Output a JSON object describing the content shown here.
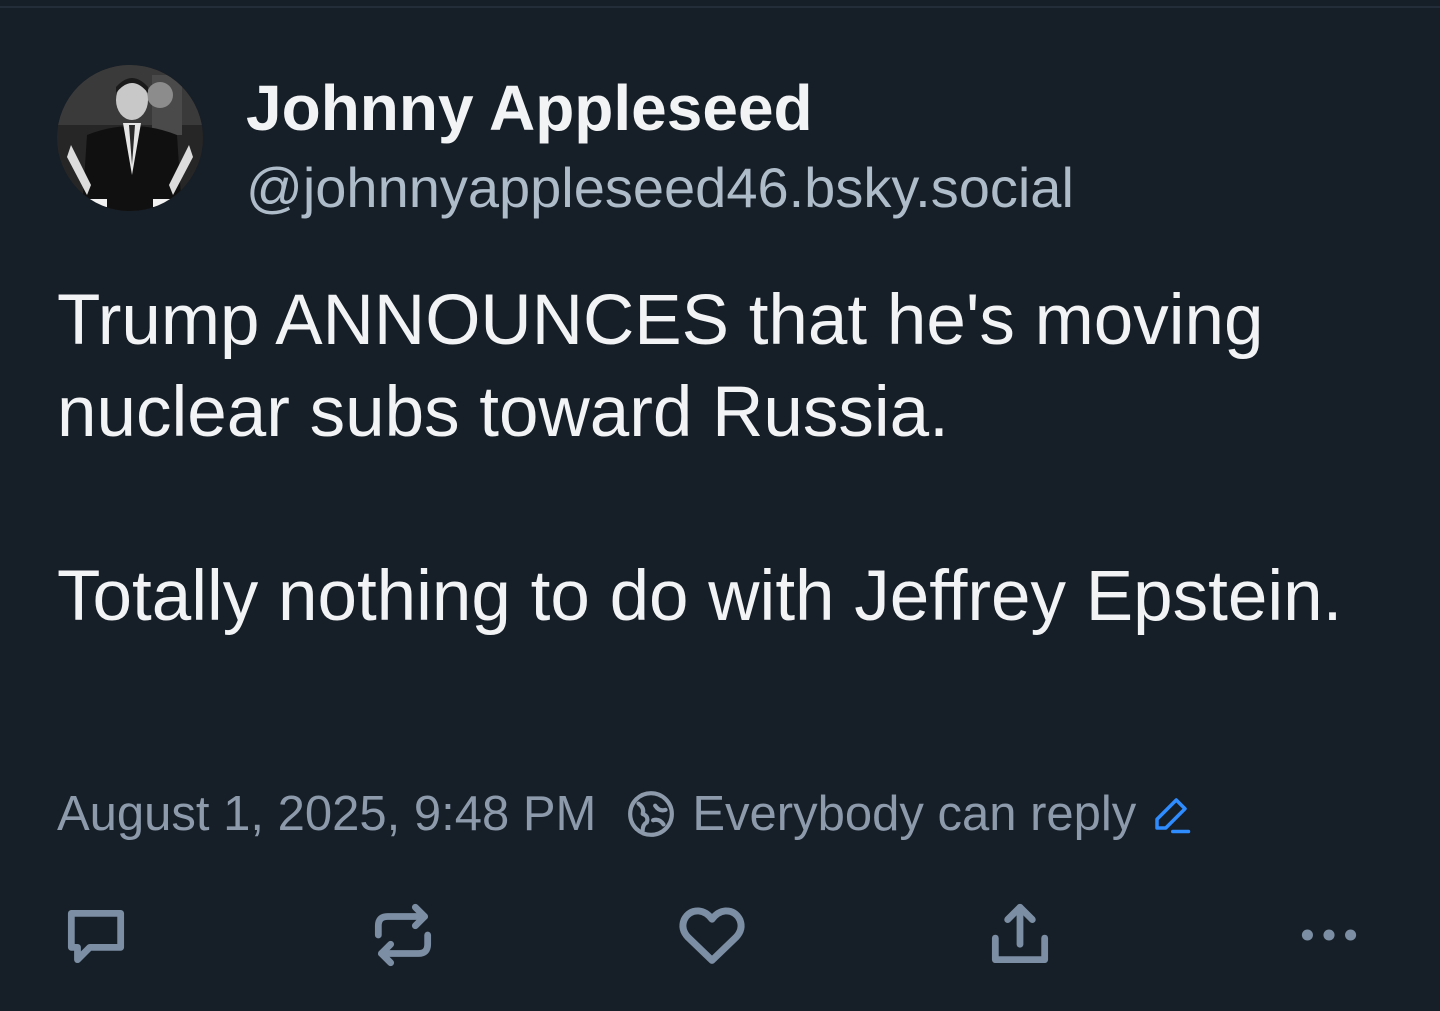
{
  "author": {
    "display_name": "Johnny Appleseed",
    "handle": "@johnnyappleseed46.bsky.social"
  },
  "post": {
    "paragraphs": [
      "Trump ANNOUNCES that he's moving nuclear subs toward Russia.",
      "Totally nothing to do with Jeffrey Epstein."
    ],
    "timestamp": "August 1, 2025, 9:48 PM",
    "reply_setting": "Everybody can reply"
  },
  "icons": {
    "reply": "reply-icon",
    "repost": "repost-icon",
    "like": "heart-icon",
    "share": "share-icon",
    "more": "more-icon",
    "globe": "globe-icon",
    "edit": "pencil-icon"
  },
  "colors": {
    "background": "#161e27",
    "primary_text": "#f1f3f5",
    "secondary_text": "#8c9aab",
    "action_icon": "#7b8ea3",
    "accent": "#2f8cff"
  }
}
